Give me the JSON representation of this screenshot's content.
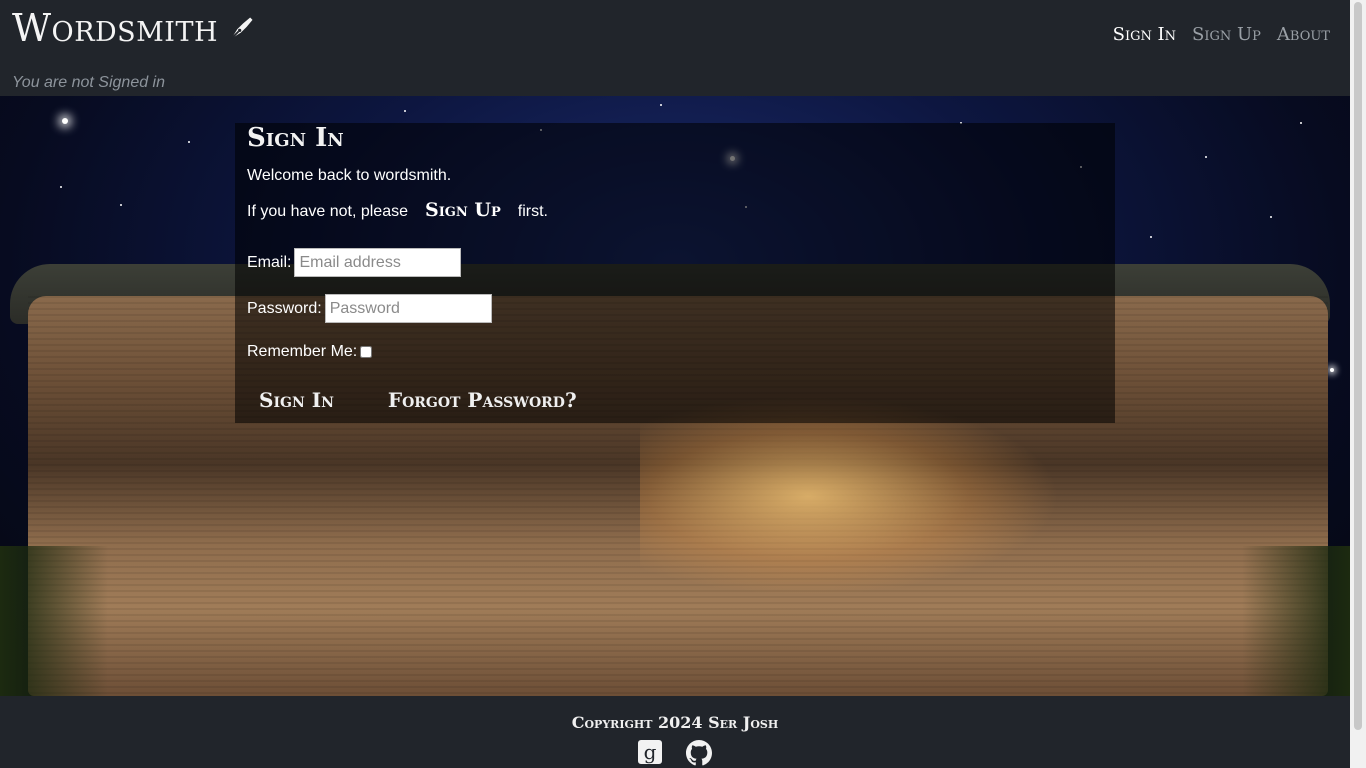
{
  "header": {
    "brand": "Wordsmith",
    "status": "You are not Signed in",
    "nav": {
      "sign_in": "Sign In",
      "sign_up": "Sign Up",
      "about": "About"
    }
  },
  "signin": {
    "title": "Sign In",
    "welcome": "Welcome back to wordsmith.",
    "prompt_before": "If you have not, please",
    "prompt_link": "Sign Up",
    "prompt_after": "first.",
    "email_label": "Email:",
    "email_placeholder": "Email address",
    "password_label": "Password:",
    "password_placeholder": "Password",
    "remember_label": "Remember Me:",
    "submit_label": "Sign In",
    "forgot_label": "Forgot Password?"
  },
  "footer": {
    "copyright": "Copyright 2024 Ser Josh",
    "icons": [
      "goodreads-icon",
      "github-icon"
    ]
  }
}
